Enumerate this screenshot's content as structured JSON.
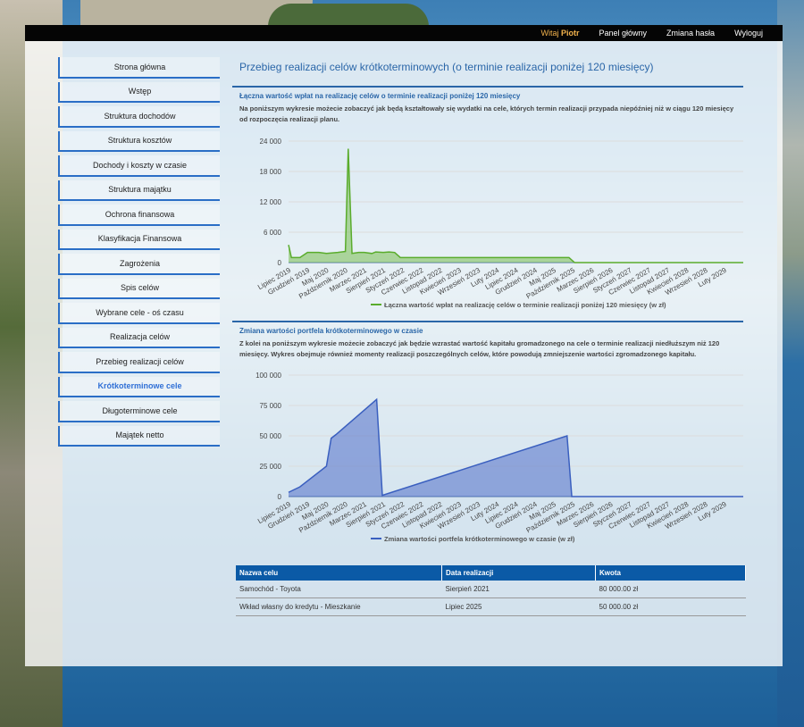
{
  "topbar": {
    "welcome": "Witaj",
    "user": "Piotr",
    "links": [
      "Panel główny",
      "Zmiana hasła",
      "Wyloguj"
    ]
  },
  "sidebar": {
    "items": [
      "Strona główna",
      "Wstęp",
      "Struktura dochodów",
      "Struktura kosztów",
      "Dochody i koszty w czasie",
      "Struktura majątku",
      "Ochrona finansowa",
      "Klasyfikacja Finansowa",
      "Zagrożenia",
      "Spis celów",
      "Wybrane cele - oś czasu",
      "Realizacja celów",
      "Przebieg realizacji celów",
      "Krótkoterminowe cele",
      "Długoterminowe cele",
      "Majątek netto"
    ],
    "active_index": 13
  },
  "page_title": "Przebieg realizacji celów krótkoterminowych (o terminie realizacji poniżej 120 miesięcy)",
  "section1": {
    "title": "Łączna wartość wpłat na realizację celów o terminie realizacji poniżej 120 miesięcy",
    "text": "Na poniższym wykresie możecie zobaczyć jak będą kształtowały się wydatki na cele, których termin realizacji przypada niepóźniej niż w ciągu 120 miesięcy od rozpoczęcia realizacji planu."
  },
  "section2": {
    "title": "Zmiana wartości portfela krótkoterminowego w czasie",
    "text": "Z kolei na poniższym wykresie możecie zobaczyć jak będzie wzrastać wartość kapitału gromadzonego na cele o terminie realizacji niedłuższym niż 120 miesięcy. Wykres obejmuje również momenty realizacji poszczególnych celów, które powodują zmniejszenie wartości zgromadzonego kapitału."
  },
  "chart_data": [
    {
      "type": "area",
      "title": "",
      "xlabel": "",
      "ylabel": "",
      "ylim": [
        0,
        24000
      ],
      "yticks": [
        "24 000",
        "18 000",
        "12 000",
        "6 000",
        "0"
      ],
      "ytick_values": [
        24000,
        18000,
        12000,
        6000,
        0
      ],
      "categories": [
        "Lipiec 2019",
        "Grudzień 2019",
        "Maj 2020",
        "Październik 2020",
        "Marzec 2021",
        "Sierpień 2021",
        "Styczeń 2022",
        "Czerwiec 2022",
        "Listopad 2022",
        "Kwiecień 2023",
        "Wrzesień 2023",
        "Luty 2024",
        "Lipiec 2024",
        "Grudzień 2024",
        "Maj 2025",
        "Październik 2025",
        "Marzec 2026",
        "Sierpień 2026",
        "Styczeń 2027",
        "Czerwiec 2027",
        "Listopad 2027",
        "Kwiecień 2028",
        "Wrzesień 2028",
        "Luty 2029"
      ],
      "series": [
        {
          "name": "Łączna wartość wpłat na realizację celów o terminie realizacji poniżej 120 miesięcy (w zł)",
          "color": "#5aac2c",
          "fill": "rgba(120,190,80,0.55)",
          "points": [
            [
              0,
              3500
            ],
            [
              0.15,
              1000
            ],
            [
              0.6,
              1000
            ],
            [
              1.0,
              2000
            ],
            [
              1.6,
              2000
            ],
            [
              2.0,
              1800
            ],
            [
              2.6,
              2000
            ],
            [
              3.0,
              2200
            ],
            [
              3.15,
              22500
            ],
            [
              3.35,
              1800
            ],
            [
              3.7,
              2000
            ],
            [
              4.0,
              2000
            ],
            [
              4.4,
              1800
            ],
            [
              4.6,
              2100
            ],
            [
              5.0,
              2000
            ],
            [
              5.3,
              2100
            ],
            [
              5.6,
              2000
            ],
            [
              5.9,
              1000
            ],
            [
              14.8,
              1000
            ],
            [
              15.1,
              0
            ],
            [
              24,
              0
            ]
          ]
        }
      ]
    },
    {
      "type": "area",
      "title": "",
      "xlabel": "",
      "ylabel": "",
      "ylim": [
        0,
        100000
      ],
      "yticks": [
        "100 000",
        "75 000",
        "50 000",
        "25 000",
        "0"
      ],
      "ytick_values": [
        100000,
        75000,
        50000,
        25000,
        0
      ],
      "categories": [
        "Lipiec 2019",
        "Grudzień 2019",
        "Maj 2020",
        "Październik 2020",
        "Marzec 2021",
        "Sierpień 2021",
        "Styczeń 2022",
        "Czerwiec 2022",
        "Listopad 2022",
        "Kwiecień 2023",
        "Wrzesień 2023",
        "Luty 2024",
        "Lipiec 2024",
        "Grudzień 2024",
        "Maj 2025",
        "Październik 2025",
        "Marzec 2026",
        "Sierpień 2026",
        "Styczeń 2027",
        "Czerwiec 2027",
        "Listopad 2027",
        "Kwiecień 2028",
        "Wrzesień 2028",
        "Luty 2029"
      ],
      "series": [
        {
          "name": "Zmiana wartości portfela krótkoterminowego w czasie (w zł)",
          "color": "#3a5fbf",
          "fill": "rgba(80,110,200,0.55)",
          "points": [
            [
              0,
              3500
            ],
            [
              0.6,
              8000
            ],
            [
              2.0,
              25000
            ],
            [
              2.25,
              48000
            ],
            [
              2.5,
              51000
            ],
            [
              4.65,
              80000
            ],
            [
              4.95,
              1000
            ],
            [
              14.7,
              50000
            ],
            [
              14.95,
              0
            ],
            [
              24,
              0
            ]
          ]
        }
      ]
    }
  ],
  "table": {
    "headers": [
      "Nazwa celu",
      "Data realizacji",
      "Kwota"
    ],
    "rows": [
      [
        "Samochód - Toyota",
        "Sierpień 2021",
        "80 000.00 zł"
      ],
      [
        "Wkład własny do kredytu - Mieszkanie",
        "Lipiec 2025",
        "50 000.00 zł"
      ]
    ]
  }
}
